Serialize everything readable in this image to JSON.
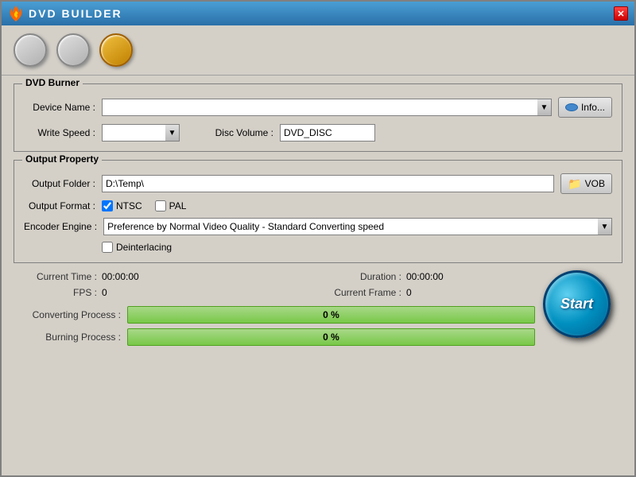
{
  "window": {
    "title": "DVD BUILDER",
    "close_label": "✕"
  },
  "toolbar": {
    "btn1_label": "",
    "btn2_label": "",
    "btn3_label": ""
  },
  "dvd_burner": {
    "group_label": "DVD Burner",
    "device_name_label": "Device Name :",
    "device_name_value": "",
    "info_btn_label": "Info...",
    "write_speed_label": "Write Speed :",
    "write_speed_value": "",
    "disc_volume_label": "Disc Volume :",
    "disc_volume_value": "DVD_DISC"
  },
  "output_property": {
    "group_label": "Output Property",
    "output_folder_label": "Output Folder :",
    "output_folder_value": "D:\\Temp\\",
    "vob_btn_label": "VOB",
    "output_format_label": "Output Format :",
    "ntsc_label": "NTSC",
    "ntsc_checked": true,
    "pal_label": "PAL",
    "pal_checked": false,
    "encoder_engine_label": "Encoder Engine :",
    "encoder_engine_value": "Preference by Normal Video Quality - Standard Converting speed",
    "deinterlacing_label": "Deinterlacing",
    "deinterlacing_checked": false
  },
  "stats": {
    "current_time_label": "Current Time :",
    "current_time_value": "00:00:00",
    "duration_label": "Duration :",
    "duration_value": "00:00:00",
    "fps_label": "FPS :",
    "fps_value": "0",
    "current_frame_label": "Current Frame :",
    "current_frame_value": "0"
  },
  "progress": {
    "converting_label": "Converting Process :",
    "converting_value": "0 %",
    "burning_label": "Burning Process :",
    "burning_value": "0 %"
  },
  "start_btn_label": "Start"
}
